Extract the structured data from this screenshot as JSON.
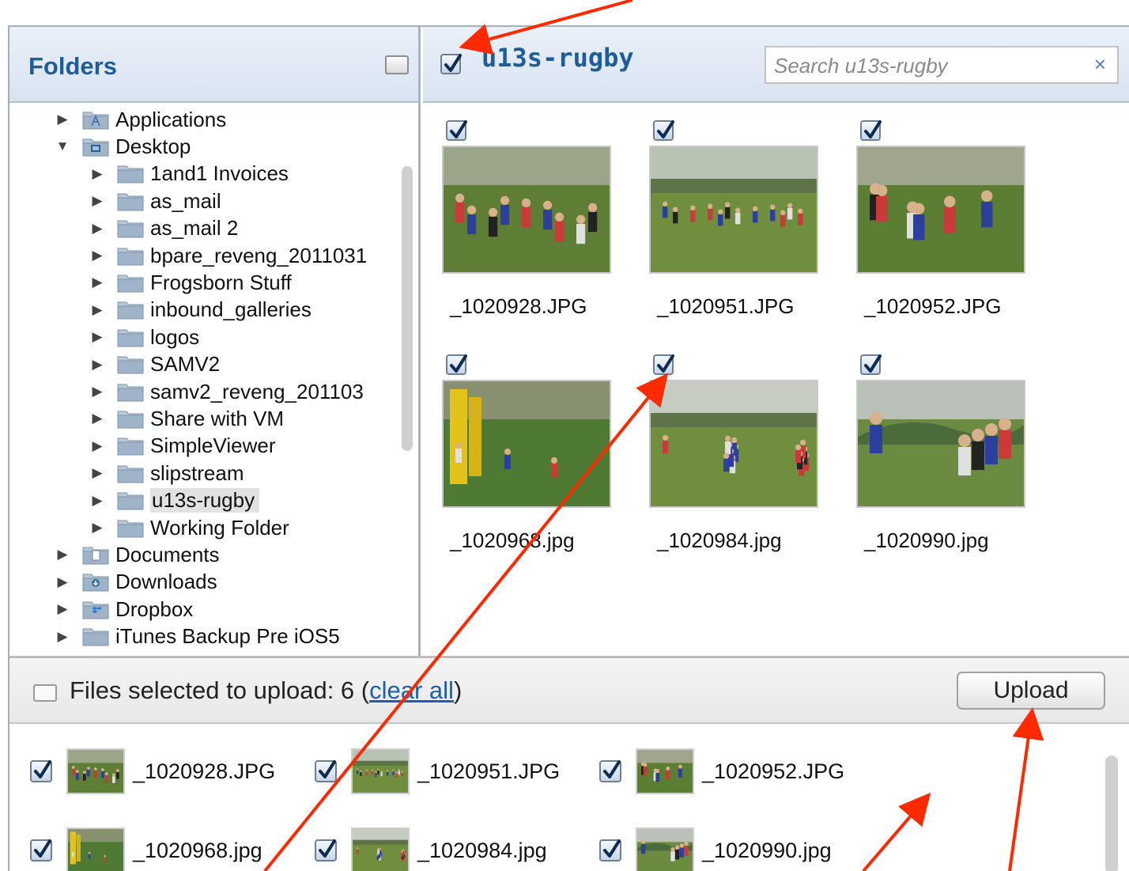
{
  "folders": {
    "title": "Folders",
    "tree": [
      {
        "label": "Applications",
        "expanded": false,
        "icon": "applications-folder-icon"
      },
      {
        "label": "Desktop",
        "expanded": true,
        "icon": "desktop-folder-icon"
      },
      {
        "label": "1and1 Invoices",
        "expanded": false,
        "icon": "folder-icon"
      },
      {
        "label": "as_mail",
        "expanded": false,
        "icon": "folder-icon"
      },
      {
        "label": "as_mail 2",
        "expanded": false,
        "icon": "folder-icon"
      },
      {
        "label": "bpare_reveng_2011031",
        "expanded": false,
        "icon": "folder-icon"
      },
      {
        "label": "Frogsborn Stuff",
        "expanded": false,
        "icon": "folder-icon"
      },
      {
        "label": "inbound_galleries",
        "expanded": false,
        "icon": "folder-icon"
      },
      {
        "label": "logos",
        "expanded": false,
        "icon": "folder-icon"
      },
      {
        "label": "SAMV2",
        "expanded": false,
        "icon": "folder-icon"
      },
      {
        "label": "samv2_reveng_201103",
        "expanded": false,
        "icon": "folder-icon"
      },
      {
        "label": "Share with VM",
        "expanded": false,
        "icon": "folder-icon"
      },
      {
        "label": "SimpleViewer",
        "expanded": false,
        "icon": "folder-icon"
      },
      {
        "label": "slipstream",
        "expanded": false,
        "icon": "folder-icon"
      },
      {
        "label": "u13s-rugby",
        "expanded": false,
        "icon": "folder-icon",
        "selected": true
      },
      {
        "label": "Working Folder",
        "expanded": false,
        "icon": "folder-icon"
      },
      {
        "label": "Documents",
        "expanded": false,
        "icon": "documents-folder-icon"
      },
      {
        "label": "Downloads",
        "expanded": false,
        "icon": "downloads-folder-icon"
      },
      {
        "label": "Dropbox",
        "expanded": false,
        "icon": "dropbox-folder-icon"
      },
      {
        "label": "iTunes Backup Pre iOS5",
        "expanded": false,
        "icon": "folder-icon"
      }
    ]
  },
  "main": {
    "folder_title": "u13s-rugby",
    "folder_checked": true,
    "search": {
      "placeholder": "Search u13s-rugby",
      "value": ""
    },
    "clear_search_glyph": "×",
    "thumbnails": [
      {
        "name": "_1020928.JPG",
        "checked": true
      },
      {
        "name": "_1020951.JPG",
        "checked": true
      },
      {
        "name": "_1020952.JPG",
        "checked": true
      },
      {
        "name": "_1020968.jpg",
        "checked": true
      },
      {
        "name": "_1020984.jpg",
        "checked": true
      },
      {
        "name": "_1020990.jpg",
        "checked": true
      }
    ]
  },
  "upload": {
    "summary_prefix": "Files selected to upload: 6 (",
    "clear_all": "clear all",
    "summary_suffix": ")",
    "button_label": "Upload",
    "selected_files": [
      {
        "name": "_1020928.JPG",
        "checked": true
      },
      {
        "name": "_1020951.JPG",
        "checked": true
      },
      {
        "name": "_1020952.JPG",
        "checked": true
      },
      {
        "name": "_1020968.jpg",
        "checked": true
      },
      {
        "name": "_1020984.jpg",
        "checked": true
      },
      {
        "name": "_1020990.jpg",
        "checked": true
      }
    ]
  },
  "colors": {
    "accent_title": "#1f5d99",
    "annotation_arrow": "#ff2a00",
    "link": "#1a5fb4"
  }
}
